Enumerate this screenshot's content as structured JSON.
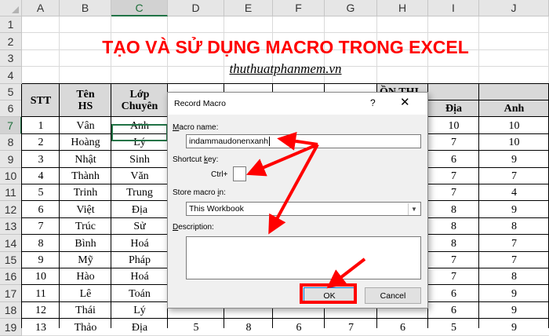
{
  "columns": [
    "A",
    "B",
    "C",
    "D",
    "E",
    "F",
    "G",
    "H",
    "I",
    "J"
  ],
  "rows": [
    "1",
    "2",
    "3",
    "4",
    "5",
    "6",
    "7",
    "8",
    "9",
    "10",
    "11",
    "12",
    "13",
    "14",
    "15",
    "16",
    "17",
    "18",
    "19"
  ],
  "title": "TẠO VÀ SỬ DỤNG MACRO TRONG EXCEL",
  "subtitle": "thuthuatphanmem.vn",
  "table": {
    "headers": {
      "stt": "STT",
      "ten": "Tên\nHS",
      "lop": "Lớp\nChuyên",
      "diem_partial": "ỒN THI",
      "dia": "Địa",
      "anh": "Anh"
    },
    "rows": [
      {
        "stt": "1",
        "ten": "Vân",
        "lop": "Anh",
        "d": "",
        "e": "",
        "f": "",
        "g": "",
        "h": "",
        "i": "10",
        "j": "10"
      },
      {
        "stt": "2",
        "ten": "Hoàng",
        "lop": "Lý",
        "d": "",
        "e": "",
        "f": "",
        "g": "",
        "h": "",
        "i": "7",
        "j": "10"
      },
      {
        "stt": "3",
        "ten": "Nhật",
        "lop": "Sinh",
        "d": "",
        "e": "",
        "f": "",
        "g": "",
        "h": "",
        "i": "6",
        "j": "9"
      },
      {
        "stt": "4",
        "ten": "Thành",
        "lop": "Văn",
        "d": "",
        "e": "",
        "f": "",
        "g": "",
        "h": "",
        "i": "7",
        "j": "7"
      },
      {
        "stt": "5",
        "ten": "Trinh",
        "lop": "Trung",
        "d": "",
        "e": "",
        "f": "",
        "g": "",
        "h": "",
        "i": "7",
        "j": "4"
      },
      {
        "stt": "6",
        "ten": "Việt",
        "lop": "Địa",
        "d": "",
        "e": "",
        "f": "",
        "g": "",
        "h": "",
        "i": "8",
        "j": "9"
      },
      {
        "stt": "7",
        "ten": "Trúc",
        "lop": "Sử",
        "d": "",
        "e": "",
        "f": "",
        "g": "",
        "h": "",
        "i": "8",
        "j": "8"
      },
      {
        "stt": "8",
        "ten": "Bình",
        "lop": "Hoá",
        "d": "",
        "e": "",
        "f": "",
        "g": "",
        "h": "",
        "i": "8",
        "j": "7"
      },
      {
        "stt": "9",
        "ten": "Mỹ",
        "lop": "Pháp",
        "d": "",
        "e": "",
        "f": "",
        "g": "",
        "h": "",
        "i": "7",
        "j": "7"
      },
      {
        "stt": "10",
        "ten": "Hào",
        "lop": "Hoá",
        "d": "",
        "e": "",
        "f": "",
        "g": "",
        "h": "",
        "i": "7",
        "j": "8"
      },
      {
        "stt": "11",
        "ten": "Lê",
        "lop": "Toán",
        "d": "",
        "e": "",
        "f": "",
        "g": "",
        "h": "",
        "i": "6",
        "j": "9"
      },
      {
        "stt": "12",
        "ten": "Thái",
        "lop": "Lý",
        "d": "",
        "e": "",
        "f": "",
        "g": "",
        "h": "",
        "i": "6",
        "j": "9"
      },
      {
        "stt": "13",
        "ten": "Thảo",
        "lop": "Địa",
        "d": "5",
        "e": "8",
        "f": "6",
        "g": "7",
        "h": "6",
        "i": "5",
        "j": "9"
      }
    ]
  },
  "dialog": {
    "title": "Record Macro",
    "help": "?",
    "close": "✕",
    "macro_name_label": "Macro name:",
    "macro_name_value": "indammaudonenxanh",
    "shortcut_label": "Shortcut key:",
    "ctrl_label": "Ctrl+",
    "shortcut_value": "",
    "store_label": "Store macro in:",
    "store_value": "This Workbook",
    "description_label": "Description:",
    "description_value": "",
    "ok": "OK",
    "cancel": "Cancel"
  },
  "colors": {
    "accent": "#217346",
    "annotation": "#ff0000",
    "title": "#ff0000",
    "header_fill": "#d9d9d9"
  }
}
